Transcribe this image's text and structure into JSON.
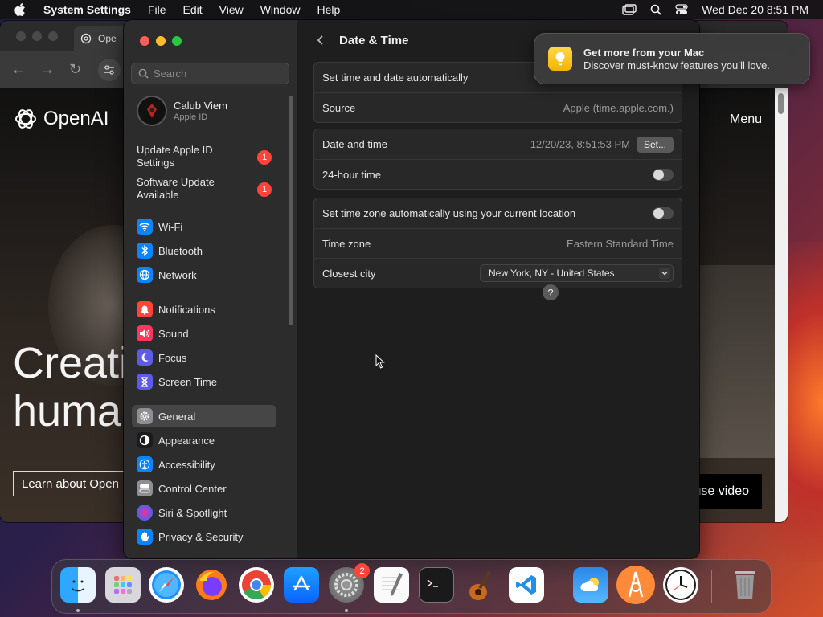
{
  "menubar": {
    "app_name": "System Settings",
    "menus": [
      "File",
      "Edit",
      "View",
      "Window",
      "Help"
    ],
    "datetime": "Wed Dec 20  8:51 PM"
  },
  "browser": {
    "tab_title": "Ope",
    "logo_text": "OpenAI",
    "menu_link": "Menu",
    "hero_line1": "Creati",
    "hero_line2": "huma",
    "learn_button": "Learn about Open",
    "video_button": "use video"
  },
  "sidebar": {
    "search_placeholder": "Search",
    "profile": {
      "name": "Calub Viem",
      "subtitle": "Apple ID"
    },
    "alerts": [
      {
        "label_line1": "Update Apple ID",
        "label_line2": "Settings",
        "badge": "1"
      },
      {
        "label_line1": "Software Update",
        "label_line2": "Available",
        "badge": "1"
      }
    ],
    "items": [
      {
        "label": "Wi-Fi",
        "icon": "wifi-icon",
        "color": "#0a84ff"
      },
      {
        "label": "Bluetooth",
        "icon": "bluetooth-icon",
        "color": "#0a84ff"
      },
      {
        "label": "Network",
        "icon": "globe-icon",
        "color": "#0a84ff"
      },
      {
        "label": "Notifications",
        "icon": "bell-icon",
        "color": "#ff453a"
      },
      {
        "label": "Sound",
        "icon": "speaker-icon",
        "color": "#ff375f"
      },
      {
        "label": "Focus",
        "icon": "moon-icon",
        "color": "#5e5ce6"
      },
      {
        "label": "Screen Time",
        "icon": "hourglass-icon",
        "color": "#5e5ce6"
      },
      {
        "label": "General",
        "icon": "gear-icon",
        "color": "#8e8e93"
      },
      {
        "label": "Appearance",
        "icon": "appearance-icon",
        "color": "#1c1c1e"
      },
      {
        "label": "Accessibility",
        "icon": "accessibility-icon",
        "color": "#0a84ff"
      },
      {
        "label": "Control Center",
        "icon": "control-center-icon",
        "color": "#8e8e93"
      },
      {
        "label": "Siri & Spotlight",
        "icon": "siri-icon",
        "color": "#bf5af2"
      },
      {
        "label": "Privacy & Security",
        "icon": "hand-icon",
        "color": "#0a84ff"
      }
    ],
    "selected": "General"
  },
  "content": {
    "title": "Date & Time",
    "group1": {
      "auto_label": "Set time and date automatically",
      "source_label": "Source",
      "source_value": "Apple (time.apple.com.)"
    },
    "group2": {
      "datetime_label": "Date and time",
      "datetime_value": "12/20/23, 8:51:53 PM",
      "set_button": "Set...",
      "hour24_label": "24-hour time",
      "hour24_on": false
    },
    "group3": {
      "tz_auto_label": "Set time zone automatically using your current location",
      "tz_auto_on": false,
      "tz_label": "Time zone",
      "tz_value": "Eastern Standard Time",
      "city_label": "Closest city",
      "city_value": "New York, NY - United States"
    },
    "help": "?"
  },
  "notification": {
    "title": "Get more from your Mac",
    "body": "Discover must-know features you’ll love."
  },
  "dock": {
    "apps": [
      "Finder",
      "Launchpad",
      "Safari",
      "Firefox",
      "Chrome",
      "App Store",
      "System Settings",
      "TextEdit",
      "Terminal",
      "GarageBand",
      "VS Code",
      "Weather",
      "Instruments",
      "Clock",
      "Trash"
    ],
    "settings_badge": "2"
  }
}
